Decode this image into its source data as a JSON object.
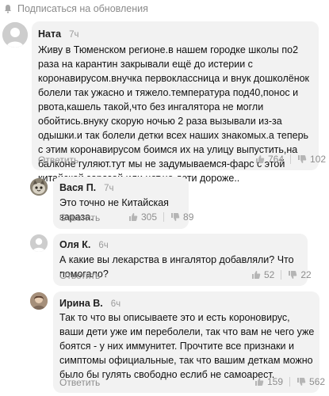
{
  "header": {
    "subscribe_label": "Подписаться на обновления"
  },
  "comments": [
    {
      "author": "Ната",
      "time": "7ч",
      "text": "Живу в Тюменском регионе.в нашем городке школы по2 раза на карантин закрывали ещё до истерии с коронавирусом.внучка первоклассница и внук дошколёнок болели так ужасно и тяжело.температура под40,понос и рвота,кашель такой,что без ингалятора не могли обойтись.внуку скорую ночью 2 раза вызывали из-за одышки.и так болели детки всех наших знакомых.а теперь с этим коронавирусом боимся их на улицу выпустить,на балконе гуляют.тут мы не задумываемся-фарс с этой китайской заразой,или нет,но дети дороже..",
      "reply": "Ответить",
      "likes": "764",
      "dislikes": "102"
    },
    {
      "author": "Вася П.",
      "time": "7ч",
      "text": "Это точно не Китайская зараза.",
      "reply": "Ответить",
      "likes": "305",
      "dislikes": "89"
    },
    {
      "author": "Оля К.",
      "time": "6ч",
      "text": "А какие вы лекарства в ингалятор добавляли? Что помогало?",
      "reply": "Ответить",
      "likes": "52",
      "dislikes": "22"
    },
    {
      "author": "Ирина В.",
      "time": "6ч",
      "text": "Так то что вы описываете это и есть короновирус, ваши дети уже им переболели, так что вам не чего уже боятся - у них иммунитет. Прочтите все признаки и симптомы официальные, так что вашим деткам можно было бы гулять свободно еслиб не самоарест.",
      "reply": "Ответить",
      "likes": "159",
      "dislikes": "562"
    }
  ]
}
